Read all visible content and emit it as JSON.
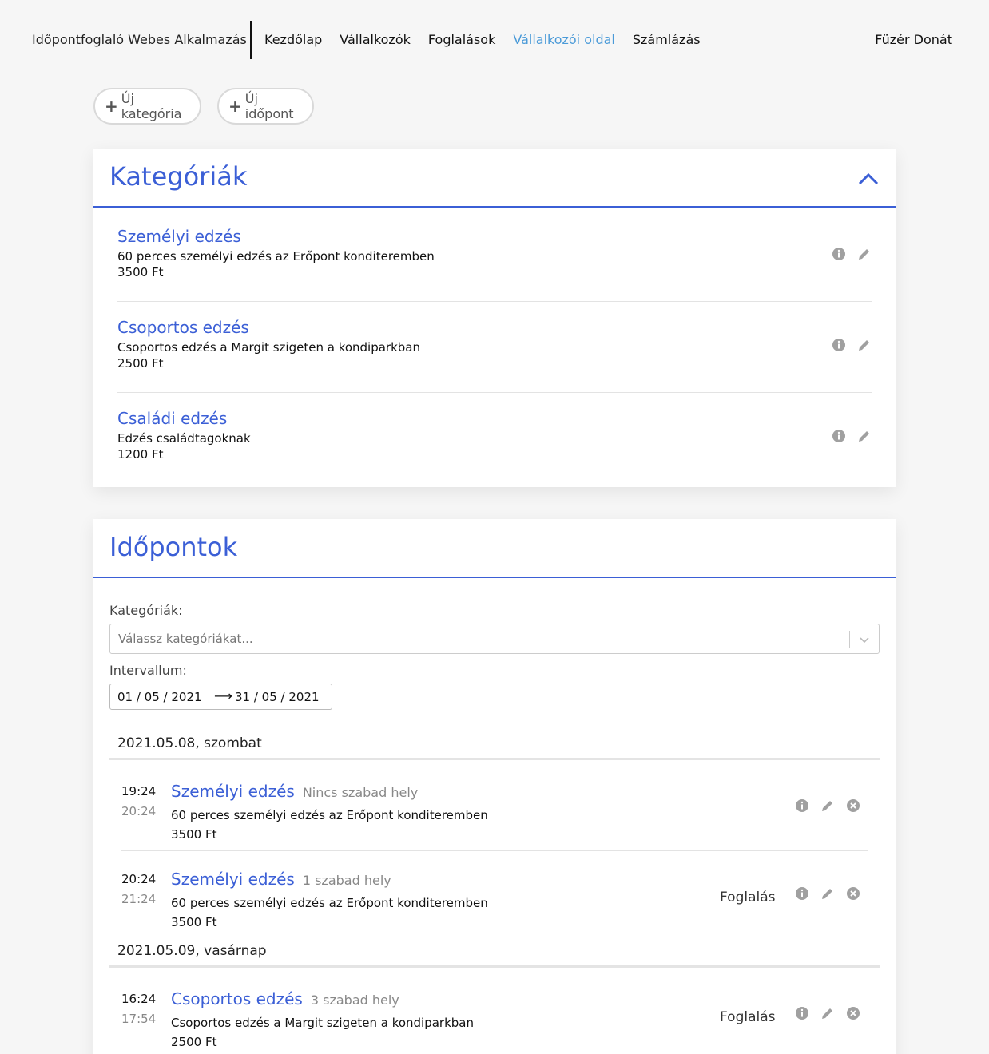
{
  "nav": {
    "brand": "Időpontfoglaló Webes Alkalmazás",
    "links": [
      "Kezdőlap",
      "Vállalkozók",
      "Foglalások",
      "Vállalkozói oldal",
      "Számlázás"
    ],
    "active_index": 3,
    "user": "Füzér Donát"
  },
  "toolbar": {
    "new_category": "Új kategória",
    "new_slot": "Új időpont"
  },
  "categories": {
    "title": "Kategóriák",
    "items": [
      {
        "title": "Személyi edzés",
        "description": "60 perces személyi edzés az Erőpont konditeremben",
        "price": "3500 Ft"
      },
      {
        "title": "Csoportos edzés",
        "description": "Csoportos edzés a Margit szigeten a kondiparkban",
        "price": "2500 Ft"
      },
      {
        "title": "Családi edzés",
        "description": "Edzés családtagoknak",
        "price": "1200 Ft"
      }
    ]
  },
  "slots": {
    "title": "Időpontok",
    "filter_label": "Kategóriák:",
    "filter_placeholder": "Válassz kategóriákat...",
    "interval_label": "Intervallum:",
    "interval_start": "01 / 05 / 2021",
    "interval_arrow": "⟶",
    "interval_end": "31 / 05 / 2021",
    "book_label": "Foglalás",
    "days": [
      {
        "label": "2021.05.08, szombat",
        "items": [
          {
            "start": "19:24",
            "end": "20:24",
            "title": "Személyi edzés",
            "status": "Nincs szabad hely",
            "description": "60 perces személyi edzés az Erőpont konditeremben",
            "price": "3500 Ft",
            "bookable": false
          },
          {
            "start": "20:24",
            "end": "21:24",
            "title": "Személyi edzés",
            "status": "1 szabad hely",
            "description": "60 perces személyi edzés az Erőpont konditeremben",
            "price": "3500 Ft",
            "bookable": true
          }
        ]
      },
      {
        "label": "2021.05.09, vasárnap",
        "items": [
          {
            "start": "16:24",
            "end": "17:54",
            "title": "Csoportos edzés",
            "status": "3 szabad hely",
            "description": "Csoportos edzés a Margit szigeten a kondiparkban",
            "price": "2500 Ft",
            "bookable": true
          }
        ]
      }
    ]
  },
  "colors": {
    "accent": "#3b5fd6",
    "nav_active": "#4a9ad8",
    "icon_gray": "#a0a0a0"
  }
}
